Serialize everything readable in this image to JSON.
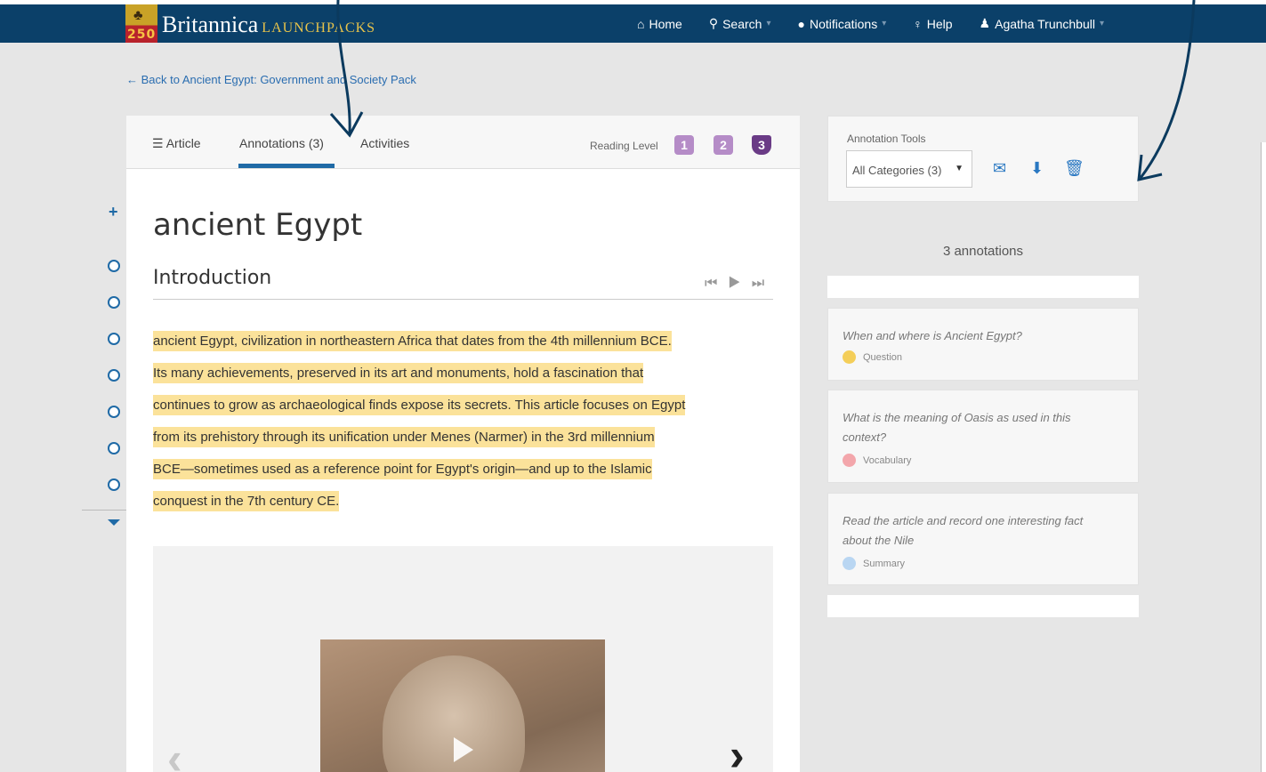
{
  "navbar": {
    "logo_number": "250",
    "brand": "Britannica",
    "brand_sub": "LAUNCHPACKS",
    "links": [
      {
        "icon": "home-icon",
        "label": "Home"
      },
      {
        "icon": "search-icon",
        "label": "Search"
      },
      {
        "icon": "comment-icon",
        "label": "Notifications"
      },
      {
        "icon": "lightbulb-icon",
        "label": "Help"
      },
      {
        "icon": "user-icon",
        "label": "Agatha Trunchbull"
      }
    ]
  },
  "back_link": "Back to Ancient Egypt: Government and Society Pack",
  "tabs": {
    "article": "Article",
    "annotations": "Annotations (3)",
    "activities": "Activities"
  },
  "reading_level": {
    "label": "Reading Level",
    "levels": [
      "1",
      "2",
      "3"
    ],
    "active": "3"
  },
  "article": {
    "title": "ancient Egypt",
    "section": "Introduction",
    "lines": [
      "ancient Egypt,  civilization in northeastern Africa that dates from the 4th millennium BCE.",
      "Its many achievements, preserved in its art and monuments, hold a fascination that",
      "continues to grow as archaeological finds expose its secrets. This article focuses on Egypt",
      "from its prehistory through its unification under Menes (Narmer) in the 3rd millennium",
      "BCE—sometimes used as a reference point for Egypt's origin—and up to the Islamic",
      "conquest in the 7th century CE."
    ]
  },
  "annotation_tools": {
    "label": "Annotation Tools",
    "filter_value": "All Categories (3)",
    "icons": [
      "envelope-icon",
      "download-icon",
      "trash-icon"
    ]
  },
  "annotations_count": "3 annotations",
  "annotations": [
    {
      "text": "When and where is Ancient Egypt?",
      "category": "Question",
      "color": "#f4ce59"
    },
    {
      "text": "What is the meaning of Oasis as used in this context?",
      "category": "Vocabulary",
      "color": "#f3a6ab"
    },
    {
      "text": "Read the article and record one interesting fact about the Nile",
      "category": "Summary",
      "color": "#b9d6f2"
    }
  ]
}
